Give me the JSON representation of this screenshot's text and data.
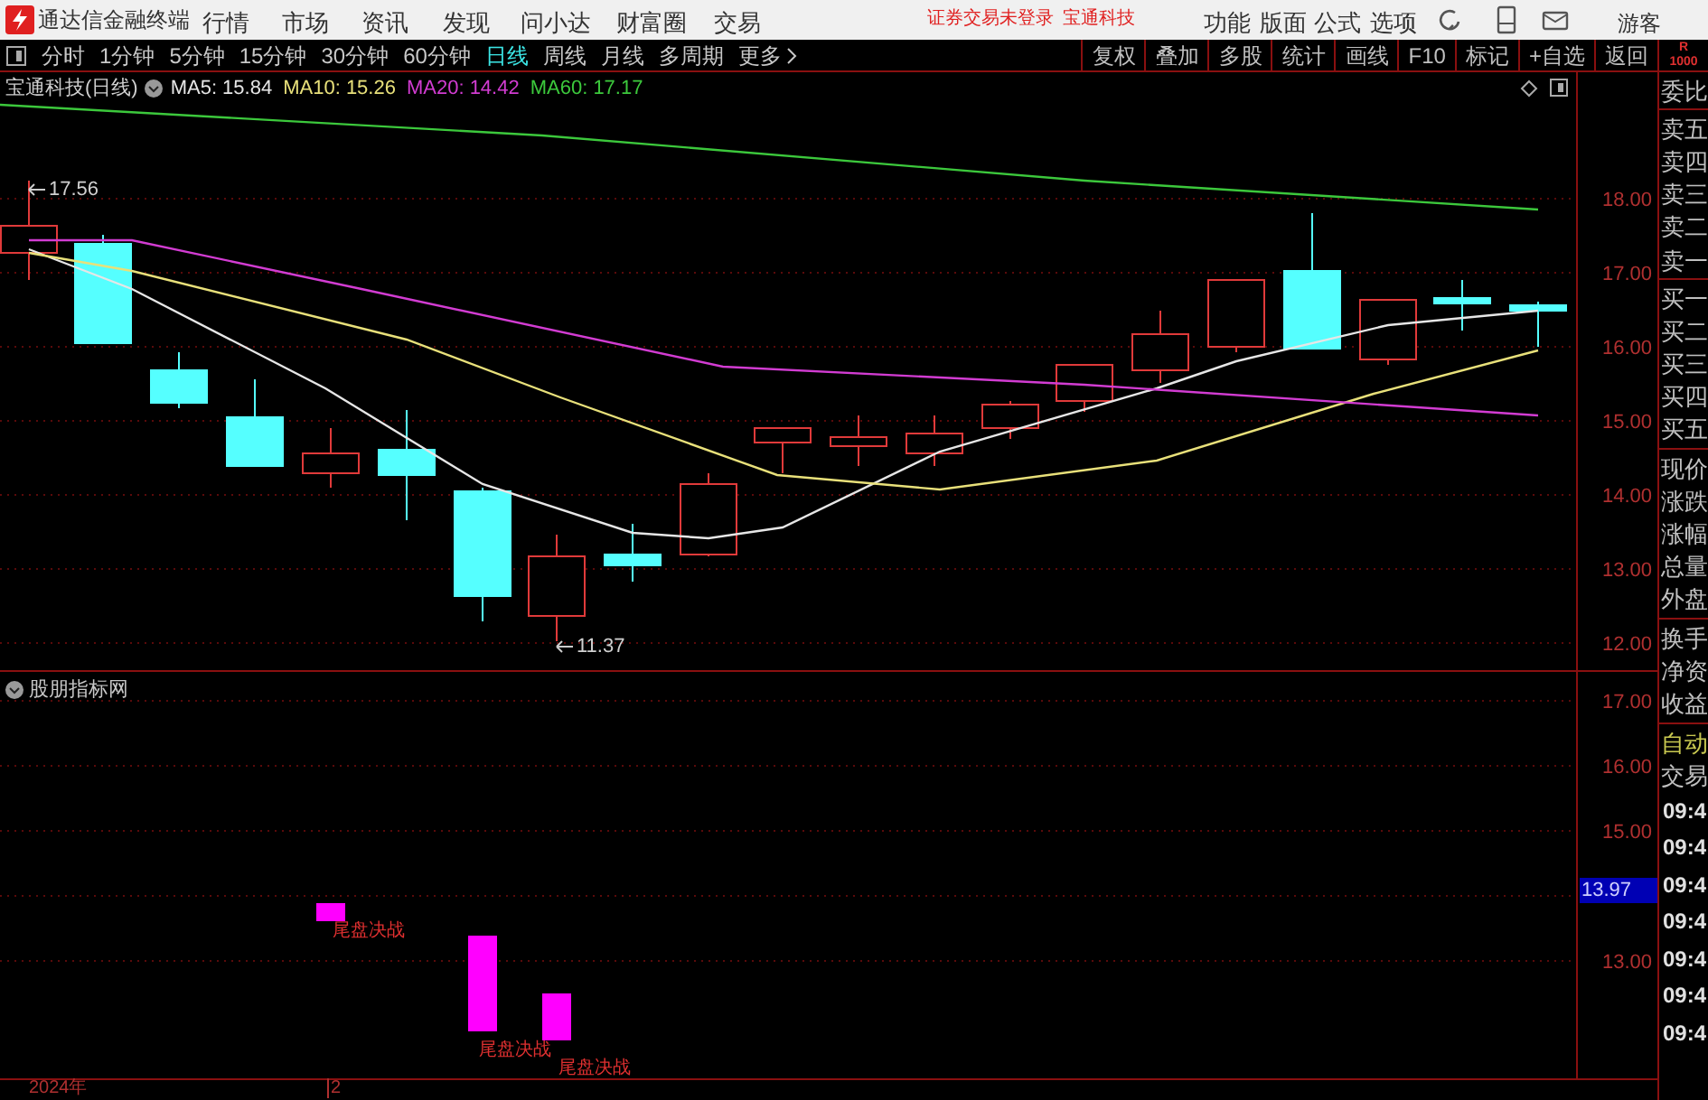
{
  "app_bar": {
    "title": "通达信金融终端",
    "menu": [
      "行情",
      "市场",
      "资讯",
      "发现",
      "问小达",
      "财富圈",
      "交易"
    ],
    "notices": [
      "证券交易未登录",
      "宝通科技"
    ],
    "tools": [
      "功能",
      "版面",
      "公式",
      "选项"
    ],
    "user": "游客"
  },
  "period_tabs": [
    {
      "label": "分时",
      "selected": false
    },
    {
      "label": "1分钟",
      "selected": false
    },
    {
      "label": "5分钟",
      "selected": false
    },
    {
      "label": "15分钟",
      "selected": false
    },
    {
      "label": "30分钟",
      "selected": false
    },
    {
      "label": "60分钟",
      "selected": false
    },
    {
      "label": "日线",
      "selected": true
    },
    {
      "label": "周线",
      "selected": false
    },
    {
      "label": "月线",
      "selected": false
    },
    {
      "label": "多周期",
      "selected": false
    }
  ],
  "more": "更多",
  "chart_tools": [
    "复权",
    "叠加",
    "多股",
    "统计",
    "画线",
    "F10",
    "标记",
    "+自选",
    "返回"
  ],
  "main_chart": {
    "title": "宝通科技(日线)",
    "indicators": [
      {
        "label": "MA5: 15.84",
        "color": "#e6e6e6"
      },
      {
        "label": "MA10: 15.26",
        "color": "#e8e07a"
      },
      {
        "label": "MA20: 14.42",
        "color": "#d23cd2"
      },
      {
        "label": "MA60: 17.17",
        "color": "#3cc83c"
      }
    ],
    "yaxis": [
      "18.00",
      "17.00",
      "16.00",
      "15.00",
      "14.00",
      "13.00",
      "12.00"
    ],
    "high_label": "17.56",
    "low_label": "11.37"
  },
  "lower_panel": {
    "title": "股朋指标网",
    "yaxis": [
      "17.00",
      "16.00",
      "15.00",
      "13.00"
    ],
    "cursor_value": "13.97",
    "signals": [
      "尾盘决战",
      "尾盘决战",
      "尾盘决战"
    ]
  },
  "time_axis": [
    "2024年",
    "2"
  ],
  "side_panel": {
    "badge": [
      "R",
      "1000"
    ],
    "groups": [
      [
        "委比"
      ],
      [
        "卖五",
        "卖四",
        "卖三",
        "卖二",
        "卖一"
      ],
      [
        "买一",
        "买二",
        "买三",
        "买四",
        "买五"
      ],
      [
        "现价",
        "涨跌",
        "涨幅",
        "总量",
        "外盘"
      ],
      [
        "换手",
        "净资",
        "收益"
      ]
    ],
    "auto_trade": [
      "自动",
      "交易"
    ],
    "times": [
      "09:4",
      "09:4",
      "09:4",
      "09:4",
      "09:4",
      "09:4",
      "09:4"
    ]
  }
}
